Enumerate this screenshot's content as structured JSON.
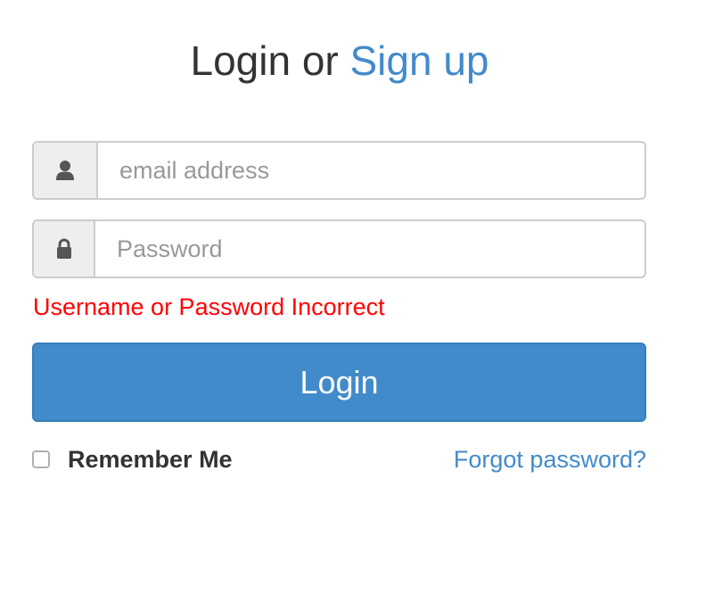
{
  "header": {
    "title_prefix": "Login or ",
    "signup_link": "Sign up"
  },
  "email": {
    "icon": "user-icon",
    "placeholder": "email address",
    "value": ""
  },
  "password": {
    "icon": "lock-icon",
    "placeholder": "Password",
    "value": ""
  },
  "error_message": "Username or Password Incorrect",
  "login_button": "Login",
  "remember_me": {
    "label": "Remember Me",
    "checked": false
  },
  "forgot_password": "Forgot password?",
  "colors": {
    "accent": "#428bca",
    "error": "#ff0000",
    "text": "#333333"
  }
}
